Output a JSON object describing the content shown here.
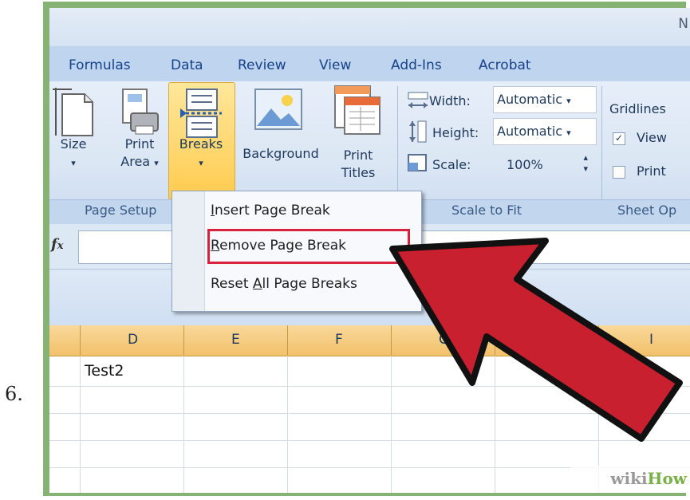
{
  "step_number": "6.",
  "title_fragment": "N",
  "tabs": [
    "Formulas",
    "Data",
    "Review",
    "View",
    "Add-Ins",
    "Acrobat"
  ],
  "page_setup": {
    "size_label": "Size",
    "print_area_label_1": "Print",
    "print_area_label_2": "Area",
    "breaks_label": "Breaks",
    "background_label": "Background",
    "print_titles_label_1": "Print",
    "print_titles_label_2": "Titles",
    "group_label": "Page Setup"
  },
  "scale_to_fit": {
    "width_label": "Width:",
    "width_value": "Automatic",
    "height_label": "Height:",
    "height_value": "Automatic",
    "scale_label": "Scale:",
    "scale_value": "100%",
    "group_label": "Scale to Fit"
  },
  "sheet_options": {
    "gridlines_label": "Gridlines",
    "view_label": "View",
    "print_label": "Print",
    "group_label": "Sheet Op"
  },
  "breaks_menu": {
    "insert": {
      "pre": "",
      "key": "I",
      "post": "nsert Page Break"
    },
    "remove": {
      "pre": "",
      "key": "R",
      "post": "emove Page Break"
    },
    "reset": {
      "pre": "Reset ",
      "key": "A",
      "post": "ll Page Breaks"
    }
  },
  "formula_bar": {
    "fx": "fx"
  },
  "columns": [
    "D",
    "E",
    "F",
    "G",
    "I"
  ],
  "cells": {
    "d1": "Test2"
  },
  "watermark": {
    "wiki": "wiki",
    "how": "How"
  },
  "colors": {
    "highlight_box": "#d8213c",
    "arrow_fill": "#c8202f",
    "breaks_highlight": "#ffcb4f"
  }
}
